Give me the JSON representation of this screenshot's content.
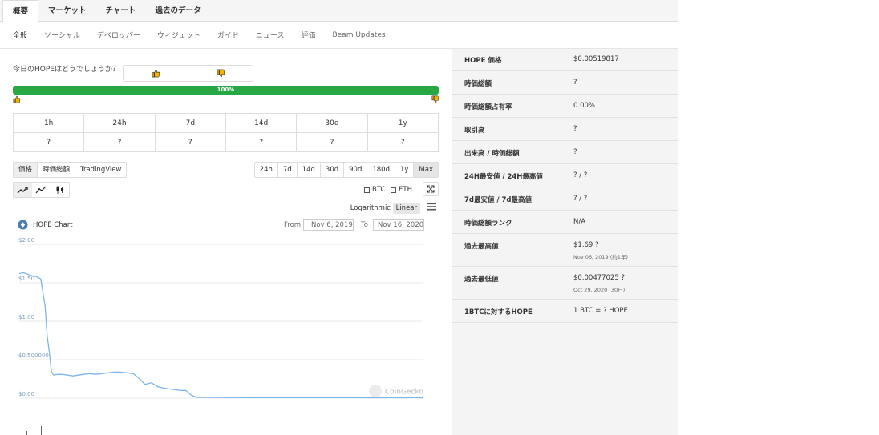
{
  "top_tabs": [
    "概要",
    "マーケット",
    "チャート",
    "過去のデータ"
  ],
  "sub_tabs": [
    "全般",
    "ソーシャル",
    "デベロッパー",
    "ウィジェット",
    "ガイド",
    "ニュース",
    "評価",
    "Beam Updates"
  ],
  "sentiment": {
    "question": "今日のHOPEはどうでしょうか？",
    "percent": 100,
    "percent_label": "100%",
    "icon_up": "thumbs-up-icon",
    "icon_down": "thumbs-down-icon"
  },
  "performance": {
    "periods": [
      "1h",
      "24h",
      "7d",
      "14d",
      "30d",
      "1y"
    ],
    "values": [
      "?",
      "?",
      "?",
      "?",
      "?",
      "?"
    ]
  },
  "chart_type_buttons": [
    "価格",
    "時価総額",
    "TradingView"
  ],
  "range_buttons": [
    "24h",
    "7d",
    "14d",
    "30d",
    "90d",
    "180d",
    "1y",
    "Max"
  ],
  "active_range": "Max",
  "compare": {
    "btc": "BTC",
    "eth": "ETH"
  },
  "scale": {
    "log": "Logarithmic",
    "linear": "Linear"
  },
  "chart_header": {
    "title": "HOPE Chart",
    "from_label": "From",
    "from_value": "Nov 6, 2019",
    "to_label": "To",
    "to_value": "Nov 16, 2020",
    "watermark": "CoinGecko"
  },
  "chart_data": {
    "type": "line",
    "title": "HOPE Chart",
    "xlabel": "",
    "ylabel": "",
    "x_range": [
      "2019-11-06",
      "2020-11-16"
    ],
    "ylim": [
      0,
      2.0
    ],
    "y_ticks": [
      "$0.00",
      "$0.500000",
      "$1.00",
      "$1.50",
      "$2.00"
    ],
    "y_tick_values": [
      0,
      0.5,
      1.0,
      1.5,
      2.0
    ],
    "grid": true,
    "color": "#7cb5ec",
    "series": [
      {
        "x": [
          "2019-11-06",
          "2019-11-10",
          "2019-11-14",
          "2019-11-18",
          "2019-11-22",
          "2019-11-26",
          "2019-11-30",
          "2019-12-02",
          "2019-12-04",
          "2019-12-06",
          "2019-12-08",
          "2019-12-12",
          "2019-12-16",
          "2019-12-21",
          "2019-12-26",
          "2019-12-31",
          "2020-01-05",
          "2020-01-10",
          "2020-01-16",
          "2020-01-22",
          "2020-01-28",
          "2020-02-02",
          "2020-02-08",
          "2020-02-14",
          "2020-02-20",
          "2020-02-26",
          "2020-03-02",
          "2020-03-08",
          "2020-03-14",
          "2020-03-20",
          "2020-03-25",
          "2020-03-30",
          "2020-04-04",
          "2020-04-09",
          "2020-04-14",
          "2020-04-19",
          "2020-04-26",
          "2020-05-15",
          "2020-06-15",
          "2020-07-15",
          "2020-08-15",
          "2020-09-15",
          "2020-10-01",
          "2020-10-15",
          "2020-10-29",
          "2020-11-05",
          "2020-11-16"
        ],
        "values": [
          1.62,
          1.63,
          1.61,
          1.59,
          1.58,
          1.55,
          1.2,
          0.8,
          0.6,
          0.34,
          0.3,
          0.31,
          0.31,
          0.3,
          0.29,
          0.3,
          0.31,
          0.32,
          0.31,
          0.32,
          0.33,
          0.34,
          0.34,
          0.33,
          0.32,
          0.25,
          0.18,
          0.2,
          0.15,
          0.13,
          0.12,
          0.11,
          0.1,
          0.1,
          0.04,
          0.01,
          0.01,
          0.008,
          0.007,
          0.006,
          0.006,
          0.006,
          0.005,
          0.006,
          0.005,
          0.006,
          0.005
        ]
      }
    ]
  },
  "stats": [
    {
      "label": "HOPE 価格",
      "value": "$0.00519817"
    },
    {
      "label": "時価総額",
      "value": "?"
    },
    {
      "label": "時価総額占有率",
      "value": "0.00%"
    },
    {
      "label": "取引高",
      "value": "?"
    },
    {
      "label": "出来高 / 時価総額",
      "value": "?"
    },
    {
      "label": "24H最安値 / 24H最高値",
      "value": "? / ?"
    },
    {
      "label": "7d最安値 / 7d最高値",
      "value": "? / ?"
    },
    {
      "label": "時価総額ランク",
      "value": "N/A"
    },
    {
      "label": "過去最高値",
      "value": "$1.69 ?",
      "sub": "Nov 06, 2019 (約1年)"
    },
    {
      "label": "過去最低値",
      "value": "$0.00477025 ?",
      "sub": "Oct 29, 2020 (30日)"
    },
    {
      "label": "1BTCに対するHOPE",
      "value": "1 BTC = ? HOPE"
    }
  ]
}
